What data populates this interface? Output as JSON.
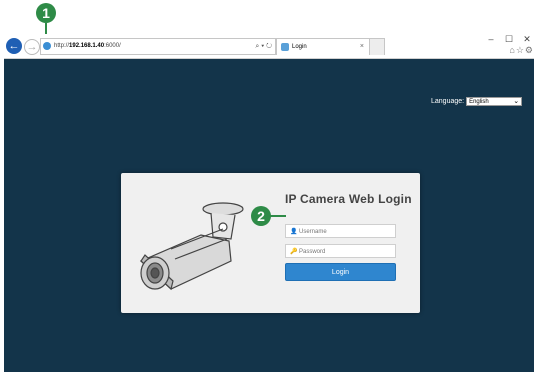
{
  "callouts": {
    "one": "1",
    "two": "2"
  },
  "browser": {
    "url_prefix": "http://",
    "url_host": "192.168.1.40",
    "url_port": ":6000/",
    "address_icons": "⌕ ▾ ↻",
    "tab_title": "Login",
    "tab_close": "×",
    "window_minimize": "–",
    "window_maximize": "☐",
    "window_close": "✕",
    "toolbar_icons": "⌂☆⚙"
  },
  "page": {
    "language_label": "Language:",
    "language_value": "English",
    "login_title": "IP Camera Web Login",
    "username_placeholder": "Username",
    "password_placeholder": "Password",
    "login_button": "Login"
  },
  "colors": {
    "page_background": "#13344a",
    "accent": "#2f86cf",
    "callout": "#2e8b47"
  }
}
